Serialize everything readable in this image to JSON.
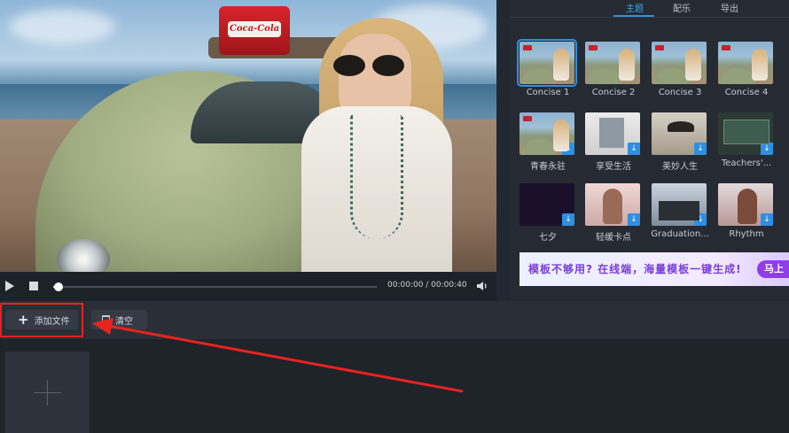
{
  "player": {
    "time": "00:00:00 / 00:00:40",
    "progress": 0.01
  },
  "tabs": [
    {
      "label": "主题",
      "active": true
    },
    {
      "label": "配乐",
      "active": false
    },
    {
      "label": "导出",
      "active": false
    }
  ],
  "themes": [
    {
      "label": "Concise 1",
      "selected": true,
      "downloadable": false,
      "style": "beach"
    },
    {
      "label": "Concise 2",
      "selected": false,
      "downloadable": false,
      "style": "beach"
    },
    {
      "label": "Concise 3",
      "selected": false,
      "downloadable": false,
      "style": "beach"
    },
    {
      "label": "Concise 4",
      "selected": false,
      "downloadable": false,
      "style": "beach"
    },
    {
      "label": "青春永驻",
      "selected": false,
      "downloadable": true,
      "style": "beach"
    },
    {
      "label": "享受生活",
      "selected": false,
      "downloadable": true,
      "style": "poster"
    },
    {
      "label": "美妙人生",
      "selected": false,
      "downloadable": true,
      "style": "hat"
    },
    {
      "label": "Teachers'...",
      "selected": false,
      "downloadable": true,
      "style": "board"
    },
    {
      "label": "七夕",
      "selected": false,
      "downloadable": true,
      "style": "night"
    },
    {
      "label": "轻缓卡点",
      "selected": false,
      "downloadable": true,
      "style": "girl"
    },
    {
      "label": "Graduation...",
      "selected": false,
      "downloadable": true,
      "style": "grad"
    },
    {
      "label": "Rhythm",
      "selected": false,
      "downloadable": true,
      "style": "rhythm"
    }
  ],
  "banner": {
    "text": "模板不够用? 在线端，海量模板一键生成!",
    "button": "马上"
  },
  "toolbar": {
    "add_label": "添加文件",
    "clear_label": "清空"
  },
  "colors": {
    "accent": "#2f8fe0",
    "highlight": "#e8231e"
  }
}
